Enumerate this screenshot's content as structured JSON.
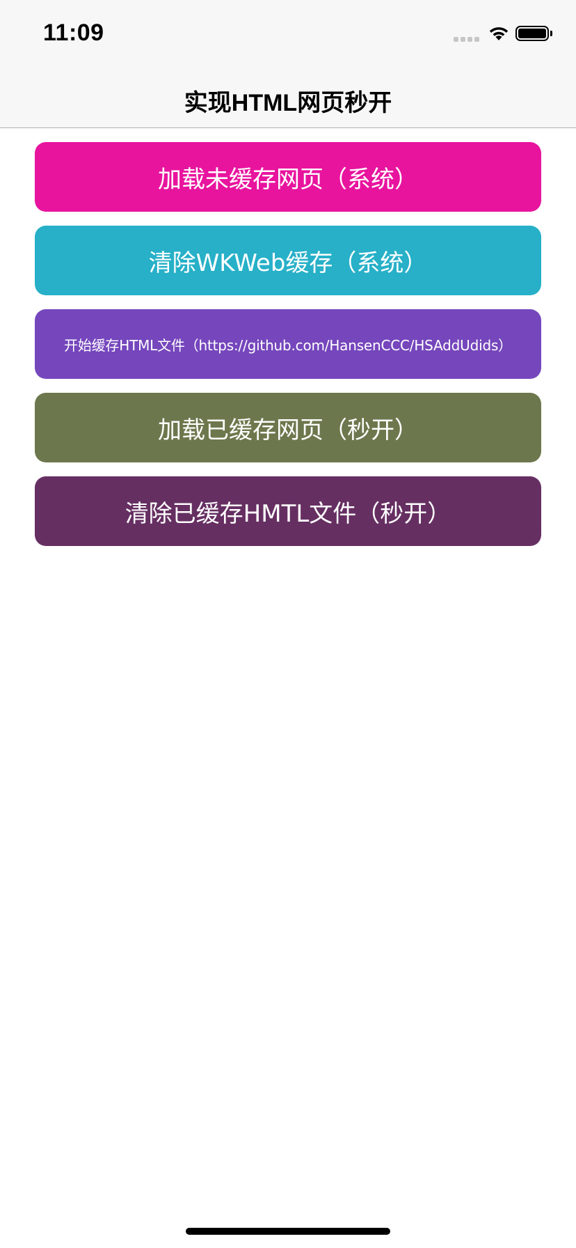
{
  "status_bar": {
    "time": "11:09",
    "signal_icon": "cellular-signal-icon",
    "wifi_icon": "wifi-icon",
    "battery_icon": "battery-icon"
  },
  "nav": {
    "title": "实现HTML网页秒开"
  },
  "buttons": [
    {
      "label": "加载未缓存网页（系统）",
      "color": "#e8149e"
    },
    {
      "label": "清除WKWeb缓存（系统）",
      "color": "#27b0c8"
    },
    {
      "label": "开始缓存HTML文件（https://github.com/HansenCCC/HSAddUdids）",
      "color": "#7546bc"
    },
    {
      "label": "加载已缓存网页（秒开）",
      "color": "#6d774d"
    },
    {
      "label": "清除已缓存HMTL文件（秒开）",
      "color": "#662f62"
    }
  ]
}
